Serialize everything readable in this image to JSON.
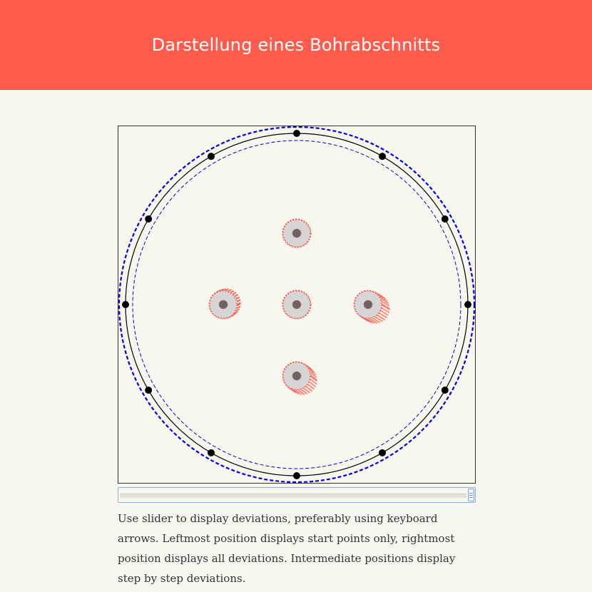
{
  "header": {
    "title": "Darstellung eines Bohrabschnitts"
  },
  "figure": {
    "colors": {
      "outer_boundary": "#0000dd",
      "inner_boundary": "#0000dd",
      "reference_circle": "#000000",
      "reference_points": "#000000",
      "hole_fill": "#d6d6d6",
      "hole_center": "#666666",
      "deviation_traces": "#ff4a3a"
    },
    "reference_point_count": 12,
    "hole_names": [
      "top-hole",
      "left-hole",
      "center-hole",
      "right-hole",
      "bottom-hole"
    ]
  },
  "slider": {
    "position": 1.0
  },
  "description": "Use slider to display deviations, preferably using keyboard arrows. Leftmost position displays start points only, rightmost position displays all deviations. Intermediate positions display step by step deviations."
}
